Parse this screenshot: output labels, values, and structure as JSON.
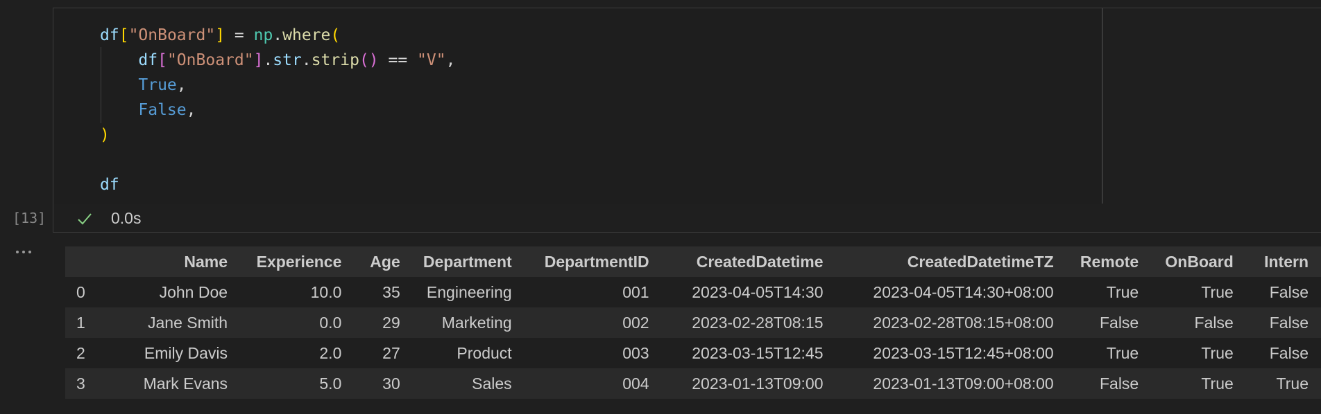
{
  "cell": {
    "execution_count": "[13]",
    "exec_time": "0.0s",
    "status_icon": "check-icon",
    "code_lines": [
      [
        {
          "t": "df",
          "c": "tk-var"
        },
        {
          "t": "[",
          "c": "tk-br1"
        },
        {
          "t": "\"OnBoard\"",
          "c": "tk-str"
        },
        {
          "t": "]",
          "c": "tk-br1"
        },
        {
          "t": " = ",
          "c": "tk-punc"
        },
        {
          "t": "np",
          "c": "tk-mod"
        },
        {
          "t": ".",
          "c": "tk-punc"
        },
        {
          "t": "where",
          "c": "tk-fn"
        },
        {
          "t": "(",
          "c": "tk-br1"
        }
      ],
      [
        {
          "t": "    ",
          "c": "tk-punc"
        },
        {
          "t": "df",
          "c": "tk-var"
        },
        {
          "t": "[",
          "c": "tk-br2"
        },
        {
          "t": "\"OnBoard\"",
          "c": "tk-str"
        },
        {
          "t": "]",
          "c": "tk-br2"
        },
        {
          "t": ".",
          "c": "tk-punc"
        },
        {
          "t": "str",
          "c": "tk-var"
        },
        {
          "t": ".",
          "c": "tk-punc"
        },
        {
          "t": "strip",
          "c": "tk-fn"
        },
        {
          "t": "()",
          "c": "tk-br2"
        },
        {
          "t": " == ",
          "c": "tk-punc"
        },
        {
          "t": "\"V\"",
          "c": "tk-str"
        },
        {
          "t": ",",
          "c": "tk-punc"
        }
      ],
      [
        {
          "t": "    ",
          "c": "tk-punc"
        },
        {
          "t": "True",
          "c": "tk-kw"
        },
        {
          "t": ",",
          "c": "tk-punc"
        }
      ],
      [
        {
          "t": "    ",
          "c": "tk-punc"
        },
        {
          "t": "False",
          "c": "tk-kw"
        },
        {
          "t": ",",
          "c": "tk-punc"
        }
      ],
      [
        {
          "t": ")",
          "c": "tk-br1"
        }
      ],
      [],
      [
        {
          "t": "df",
          "c": "tk-var"
        }
      ]
    ]
  },
  "output": {
    "columns": [
      "",
      "Name",
      "Experience",
      "Age",
      "Department",
      "DepartmentID",
      "CreatedDatetime",
      "CreatedDatetimeTZ",
      "Remote",
      "OnBoard",
      "Intern"
    ],
    "rows": [
      [
        "0",
        "John Doe",
        "10.0",
        "35",
        "Engineering",
        "001",
        "2023-04-05T14:30",
        "2023-04-05T14:30+08:00",
        "True",
        "True",
        "False"
      ],
      [
        "1",
        "Jane Smith",
        "0.0",
        "29",
        "Marketing",
        "002",
        "2023-02-28T08:15",
        "2023-02-28T08:15+08:00",
        "False",
        "False",
        "False"
      ],
      [
        "2",
        "Emily Davis",
        "2.0",
        "27",
        "Product",
        "003",
        "2023-03-15T12:45",
        "2023-03-15T12:45+08:00",
        "True",
        "True",
        "False"
      ],
      [
        "3",
        "Mark Evans",
        "5.0",
        "30",
        "Sales",
        "004",
        "2023-01-13T09:00",
        "2023-01-13T09:00+08:00",
        "False",
        "True",
        "True"
      ]
    ]
  },
  "colors": {
    "background": "#1f1f1f",
    "success_check": "#89d185"
  }
}
